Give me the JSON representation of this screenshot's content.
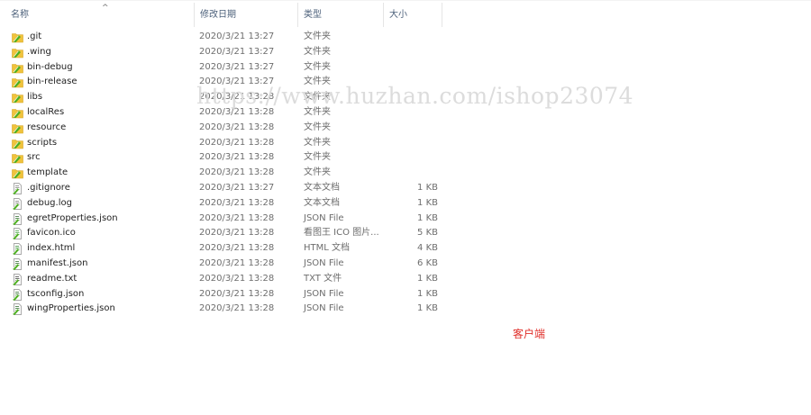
{
  "columns": {
    "name": "名称",
    "date": "修改日期",
    "type": "类型",
    "size": "大小"
  },
  "files": [
    {
      "name": ".git",
      "date": "2020/3/21 13:27",
      "type": "文件夹",
      "size": "",
      "icon": "folder-icon"
    },
    {
      "name": ".wing",
      "date": "2020/3/21 13:27",
      "type": "文件夹",
      "size": "",
      "icon": "folder-icon"
    },
    {
      "name": "bin-debug",
      "date": "2020/3/21 13:27",
      "type": "文件夹",
      "size": "",
      "icon": "folder-icon"
    },
    {
      "name": "bin-release",
      "date": "2020/3/21 13:27",
      "type": "文件夹",
      "size": "",
      "icon": "folder-icon"
    },
    {
      "name": "libs",
      "date": "2020/3/21 13:28",
      "type": "文件夹",
      "size": "",
      "icon": "folder-icon"
    },
    {
      "name": "localRes",
      "date": "2020/3/21 13:28",
      "type": "文件夹",
      "size": "",
      "icon": "folder-icon"
    },
    {
      "name": "resource",
      "date": "2020/3/21 13:28",
      "type": "文件夹",
      "size": "",
      "icon": "folder-icon"
    },
    {
      "name": "scripts",
      "date": "2020/3/21 13:28",
      "type": "文件夹",
      "size": "",
      "icon": "folder-icon"
    },
    {
      "name": "src",
      "date": "2020/3/21 13:28",
      "type": "文件夹",
      "size": "",
      "icon": "folder-icon"
    },
    {
      "name": "template",
      "date": "2020/3/21 13:28",
      "type": "文件夹",
      "size": "",
      "icon": "folder-icon"
    },
    {
      "name": ".gitignore",
      "date": "2020/3/21 13:27",
      "type": "文本文档",
      "size": "1 KB",
      "icon": "text-file-icon"
    },
    {
      "name": "debug.log",
      "date": "2020/3/21 13:28",
      "type": "文本文档",
      "size": "1 KB",
      "icon": "text-file-icon"
    },
    {
      "name": "egretProperties.json",
      "date": "2020/3/21 13:28",
      "type": "JSON File",
      "size": "1 KB",
      "icon": "json-file-icon"
    },
    {
      "name": "favicon.ico",
      "date": "2020/3/21 13:28",
      "type": "看图王 ICO 图片...",
      "size": "5 KB",
      "icon": "image-file-icon"
    },
    {
      "name": "index.html",
      "date": "2020/3/21 13:28",
      "type": "HTML 文档",
      "size": "4 KB",
      "icon": "html-file-icon"
    },
    {
      "name": "manifest.json",
      "date": "2020/3/21 13:28",
      "type": "JSON File",
      "size": "6 KB",
      "icon": "json-file-icon"
    },
    {
      "name": "readme.txt",
      "date": "2020/3/21 13:28",
      "type": "TXT 文件",
      "size": "1 KB",
      "icon": "txt-file-icon"
    },
    {
      "name": "tsconfig.json",
      "date": "2020/3/21 13:28",
      "type": "JSON File",
      "size": "1 KB",
      "icon": "json-file-icon"
    },
    {
      "name": "wingProperties.json",
      "date": "2020/3/21 13:28",
      "type": "JSON File",
      "size": "1 KB",
      "icon": "json-file-icon"
    }
  ],
  "watermark": "https://www.huzhan.com/ishop23074",
  "caption": "客户端",
  "colors": {
    "folder": "#f0c33c",
    "green_badge": "#4caf1e",
    "header_text": "#4c607a",
    "caption": "#e0302b",
    "watermark": "#dcdcdc"
  }
}
